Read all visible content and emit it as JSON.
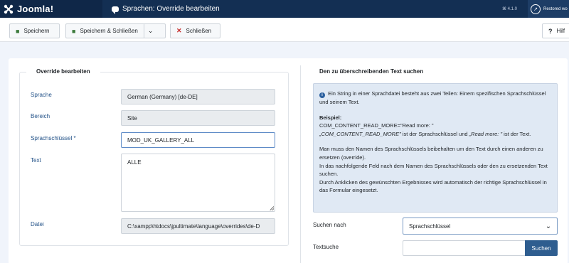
{
  "header": {
    "logo_text": "Joomla!",
    "page_title": "Sprachen: Override bearbeiten",
    "version": "⌘ 4.1.0",
    "user_label": "Restored wo"
  },
  "toolbar": {
    "save_label": "Speichern",
    "save_close_label": "Speichern & Schließen",
    "close_label": "Schließen",
    "help_label": "Hilf"
  },
  "left": {
    "legend": "Override bearbeiten",
    "fields": {
      "language_label": "Sprache",
      "language_value": "German (Germany) [de-DE]",
      "client_label": "Bereich",
      "client_value": "Site",
      "key_label": "Sprachschlüssel *",
      "key_value": "MOD_UK_GALLERY_ALL",
      "text_label": "Text",
      "text_value": "ALLE",
      "file_label": "Datei",
      "file_value": "C:\\xampp\\htdocs\\jpultimate\\language\\overrides\\de-D"
    }
  },
  "right": {
    "legend": "Den zu überschreibenden Text suchen",
    "info": {
      "intro": "Ein String in einer Sprachdatei besteht aus zwei Teilen: Einem spezifischen Sprachschlüssel und seinem Text.",
      "example_heading": "Beispiel:",
      "example_line": "COM_CONTENT_READ_MORE=\"Read more: \"",
      "example_key": "„COM_CONTENT_READ_MORE\"",
      "example_mid": " ist der Sprachschlüssel und ",
      "example_text": "„Read more: \"",
      "example_end": " ist der Text.",
      "p1": "Man muss den Namen des Sprachschlüssels beibehalten um den Text durch einen anderen zu ersetzen (override).",
      "p2": "In das nachfolgende Feld nach dem Namen des Sprachschlüssels oder den zu ersetzenden Text suchen.",
      "p3": "Durch Anklicken des gewünschten Ergebnisses wird automatisch der richtige Sprachschlüssel in das Formular eingesetzt."
    },
    "search_type_label": "Suchen nach",
    "search_type_value": "Sprachschlüssel",
    "search_text_label": "Textsuche",
    "search_text_value": "",
    "search_button": "Suchen"
  }
}
